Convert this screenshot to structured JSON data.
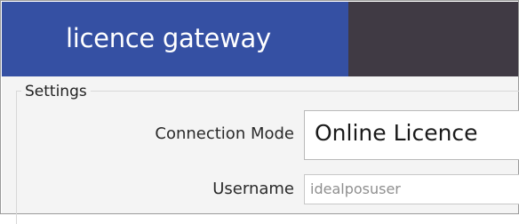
{
  "header": {
    "title": "licence gateway"
  },
  "settings": {
    "legend": "Settings",
    "connection_mode": {
      "label": "Connection Mode",
      "value": "Online Licence"
    },
    "username": {
      "label": "Username",
      "value": "idealposuser"
    }
  },
  "colors": {
    "brand_tab": "#3550a3",
    "header_dark": "#403a44",
    "panel_bg": "#f4f4f4"
  }
}
